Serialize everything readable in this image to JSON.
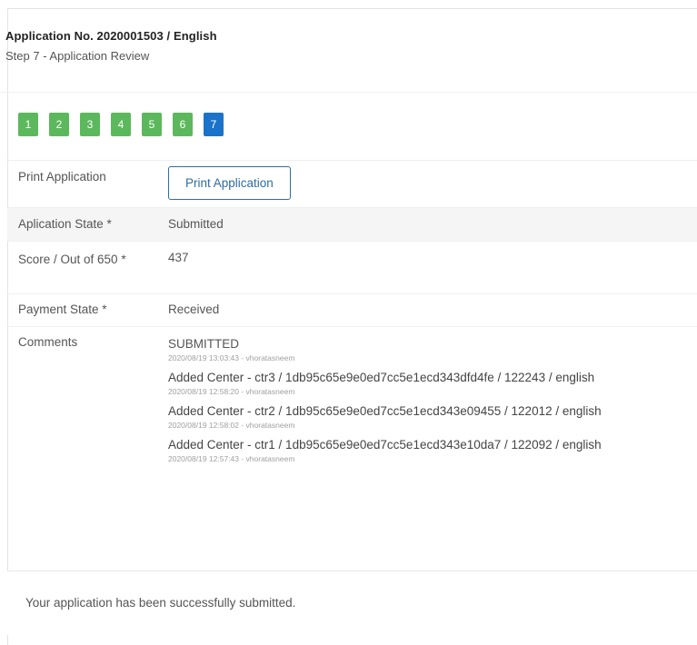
{
  "header": {
    "title": "Application No. 2020001503 / English",
    "subtitle": "Step 7 - Application Review"
  },
  "steps": [
    "1",
    "2",
    "3",
    "4",
    "5",
    "6",
    "7"
  ],
  "active_step": "7",
  "rows": {
    "print": {
      "label": "Print Application",
      "button": "Print Application"
    },
    "state": {
      "label": "Aplication State *",
      "value": "Submitted"
    },
    "score": {
      "label": "Score / Out of 650 *",
      "value": "437"
    },
    "payment": {
      "label": "Payment State *",
      "value": "Received"
    },
    "comments": {
      "label": "Comments",
      "status": "SUBMITTED",
      "status_meta": "2020/08/19 13:03:43 - vhoratasneem",
      "entries": [
        {
          "text": "Added Center - ctr3 / 1db95c65e9e0ed7cc5e1ecd343dfd4fe / 122243 / english",
          "meta": "2020/08/19 12:58:20 - vhoratasneem"
        },
        {
          "text": "Added Center - ctr2 / 1db95c65e9e0ed7cc5e1ecd343e09455 / 122012 / english",
          "meta": "2020/08/19 12:58:02 - vhoratasneem"
        },
        {
          "text": "Added Center - ctr1 / 1db95c65e9e0ed7cc5e1ecd343e10da7 / 122092 / english",
          "meta": "2020/08/19 12:57:43 - vhoratasneem"
        }
      ]
    }
  },
  "success_message": "Your application has been successfully submitted.",
  "colors": {
    "step_done": "#5cb85c",
    "step_active": "#1a73c9",
    "button_border": "#2e6da4"
  }
}
